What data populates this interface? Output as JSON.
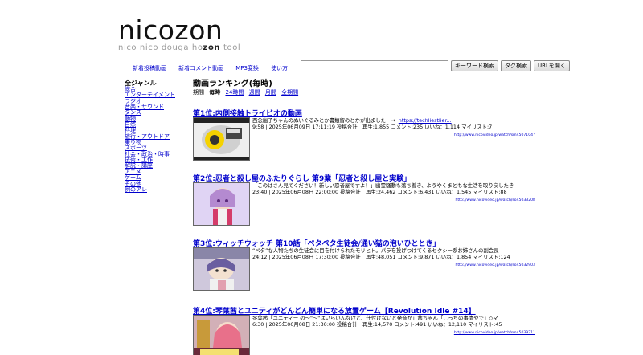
{
  "logo": {
    "main": "nicozon",
    "sub_pre": "nico nico douga ho",
    "sub_bold": "zon",
    "sub_post": " tool"
  },
  "nav": [
    "新着投稿動画",
    "新着コメント動画",
    "MP3変換",
    "使い方"
  ],
  "search": {
    "value": "",
    "placeholder": ""
  },
  "buttons": {
    "keyword": "キーワード検索",
    "tag": "タグ検索",
    "url": "URLを開く"
  },
  "sidebar": {
    "current": "全ジャンル",
    "items": [
      "総合",
      "エンターテイメント",
      "ラジオ",
      "音楽・サウンド",
      "ダンス",
      "動物",
      "自然",
      "料理",
      "旅行・アウトドア",
      "乗り物",
      "スポーツ",
      "社会・政治・時事",
      "技術・工作",
      "解説・講座",
      "アニメ",
      "ゲーム",
      "その他",
      "例のアレ"
    ]
  },
  "ranking": {
    "title": "動画ランキング(毎時)",
    "period_label": "期間",
    "period_current": "毎時",
    "periods": [
      "24時間",
      "週間",
      "月間",
      "全期間"
    ]
  },
  "entries": [
    {
      "title": "第1位:内側接触トライビオの動画",
      "desc": "西念幽子ちゃんのぬいぐるみとか書類留のとかが出ました！→",
      "desc_link": "https://techliestlier...",
      "meta": "9:58 | 2025年06月09日 17:11:19 投稿合計　再生:1,855  コメント:235  いいね：1,114   マイリスト:7",
      "url": "http://www.nicovideo.jp/watch/sm45071047",
      "thumb_bg": "#f4f4f4"
    },
    {
      "title": "第2位:忍者と殺し屋のふたりぐらし 第9業「忍者と殺し屋と実験」",
      "desc": "「このはさん見てください！新しい忍者屋ですよ！」幽霊騒動も落ち着き、ようやくまともな生活を取り戻したき",
      "desc_link": "",
      "meta": "23:40 | 2025年06月08日 22:00:00 投稿合計　再生:24,462  コメント:6,431  いいね：1,545   マイリスト:88",
      "url": "http://www.nicovideo.jp/watch/so45033208",
      "thumb_bg": "#c9b7e6"
    },
    {
      "title": "第3位:ウィッチウォッチ 第10話「ペタペタ生徒会/通い猫の泡いひととき」",
      "desc": "“ペタ”な人物たちの生徒会に目を付けられたモリヒト。パラを投げつけてくるセクシー系お姉さんの副会長",
      "desc_link": "",
      "meta": "24:12 | 2025年06月08日 17:30:00 投稿合計　再生:48,051  コメント:9,871  いいね：1,854   マイリスト:124",
      "url": "http://www.nicovideo.jp/watch/so45032903",
      "thumb_bg": "#c6bfd8"
    },
    {
      "title": "第4位:琴葉茜とユニティがどんどん簡単になる放置ゲーム【Revolution Idle #14】",
      "desc": "琴葉茜「ユニティー の〜\"〜\"はいらいんなけど、仕付けないと発音が」茜ちゃん「こっちの事情やで」◇マ",
      "desc_link": "",
      "meta": "6:30 | 2025年06月08日 21:30:00 投稿合計　再生:14,570  コメント:491  いいね：12,110   マイリスト:45",
      "url": "http://www.nicovideo.jp/watch/sm45039211",
      "thumb_bg": "#e8a0a8"
    }
  ]
}
